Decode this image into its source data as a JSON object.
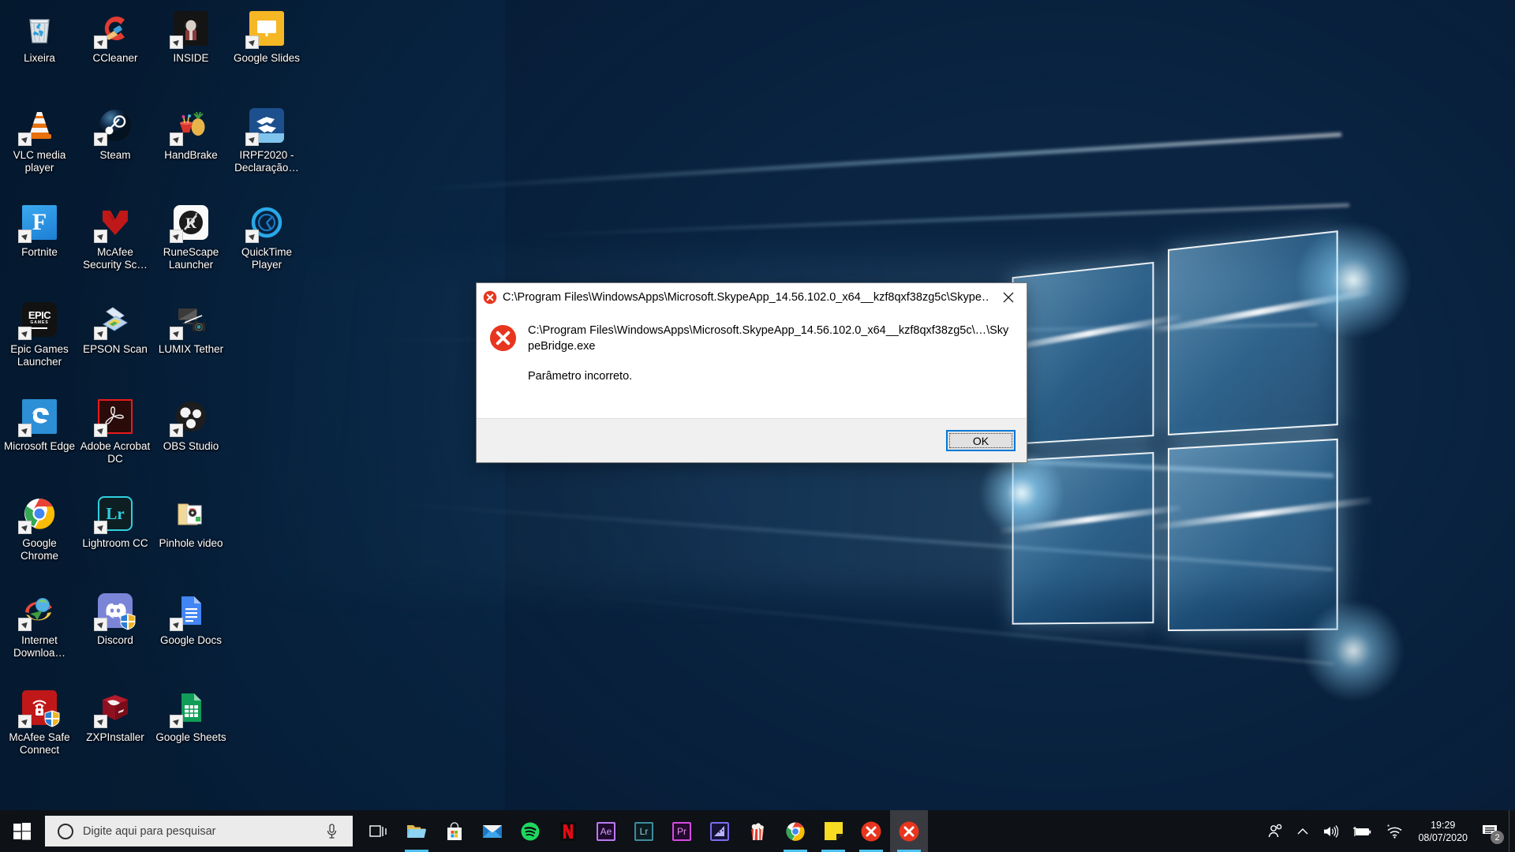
{
  "desktop": {
    "icons": [
      {
        "label": "Lixeira",
        "icon": "recycle-bin-icon",
        "shortcut": false
      },
      {
        "label": "CCleaner",
        "icon": "ccleaner-icon",
        "shortcut": true
      },
      {
        "label": "INSIDE",
        "icon": "inside-game-icon",
        "shortcut": true
      },
      {
        "label": "Google Slides",
        "icon": "google-slides-icon",
        "shortcut": true
      },
      {
        "label": "VLC media player",
        "icon": "vlc-media-player-icon",
        "shortcut": true
      },
      {
        "label": "Steam",
        "icon": "steam-icon",
        "shortcut": true
      },
      {
        "label": "HandBrake",
        "icon": "handbrake-icon",
        "shortcut": true
      },
      {
        "label": "IRPF2020 - Declaração…",
        "icon": "irpf2020-icon",
        "shortcut": true
      },
      {
        "label": "Fortnite",
        "icon": "fortnite-icon",
        "shortcut": true
      },
      {
        "label": "McAfee Security Sc…",
        "icon": "mcafee-security-icon",
        "shortcut": true
      },
      {
        "label": "RuneScape Launcher",
        "icon": "runescape-launcher-icon",
        "shortcut": true
      },
      {
        "label": "QuickTime Player",
        "icon": "quicktime-player-icon",
        "shortcut": true
      },
      {
        "label": "Epic Games Launcher",
        "icon": "epic-games-icon",
        "shortcut": true
      },
      {
        "label": "EPSON Scan",
        "icon": "epson-scan-icon",
        "shortcut": true
      },
      {
        "label": "LUMIX Tether",
        "icon": "lumix-tether-icon",
        "shortcut": true
      },
      {
        "label": "",
        "icon": "empty-slot",
        "shortcut": false
      },
      {
        "label": "Microsoft Edge",
        "icon": "microsoft-edge-icon",
        "shortcut": true
      },
      {
        "label": "Adobe Acrobat DC",
        "icon": "adobe-acrobat-icon",
        "shortcut": true
      },
      {
        "label": "OBS Studio",
        "icon": "obs-studio-icon",
        "shortcut": true
      },
      {
        "label": "",
        "icon": "empty-slot",
        "shortcut": false
      },
      {
        "label": "Google Chrome",
        "icon": "google-chrome-icon",
        "shortcut": true
      },
      {
        "label": "Lightroom CC",
        "icon": "lightroom-cc-icon",
        "shortcut": true
      },
      {
        "label": "Pinhole video",
        "icon": "folder-icon",
        "shortcut": false
      },
      {
        "label": "",
        "icon": "empty-slot",
        "shortcut": false
      },
      {
        "label": "Internet Downloa…",
        "icon": "internet-download-manager-icon",
        "shortcut": true
      },
      {
        "label": "Discord",
        "icon": "discord-icon",
        "shortcut": true
      },
      {
        "label": "Google Docs",
        "icon": "google-docs-icon",
        "shortcut": true
      },
      {
        "label": "",
        "icon": "empty-slot",
        "shortcut": false
      },
      {
        "label": "McAfee Safe Connect",
        "icon": "mcafee-safe-connect-icon",
        "shortcut": true
      },
      {
        "label": "ZXPInstaller",
        "icon": "zxpinstaller-icon",
        "shortcut": true
      },
      {
        "label": "Google Sheets",
        "icon": "google-sheets-icon",
        "shortcut": true
      },
      {
        "label": "",
        "icon": "empty-slot",
        "shortcut": false
      }
    ]
  },
  "dialog": {
    "title": "C:\\Program Files\\WindowsApps\\Microsoft.SkypeApp_14.56.102.0_x64__kzf8qxf38zg5c\\Skype…",
    "title_icon": "error-icon",
    "close_label": "✕",
    "body_icon": "error-icon",
    "message_path": "C:\\Program Files\\WindowsApps\\Microsoft.SkypeApp_14.56.102.0_x64__kzf8qxf38zg5c\\…\\SkypeBridge.exe",
    "message_reason": "Parâmetro incorreto.",
    "ok_label": "OK",
    "accent_color": "#0078d7",
    "error_color": "#e8351e"
  },
  "taskbar": {
    "start_label": "start-button",
    "search": {
      "placeholder": "Digite aqui para pesquisar",
      "cortana_icon": "cortana-circle-icon",
      "mic_icon": "microphone-icon"
    },
    "apps": [
      {
        "name": "task-view",
        "icon": "task-view-icon",
        "running": false,
        "active": false
      },
      {
        "name": "file-explorer",
        "icon": "file-explorer-icon",
        "running": true,
        "active": false
      },
      {
        "name": "microsoft-store",
        "icon": "microsoft-store-icon",
        "running": false,
        "active": false
      },
      {
        "name": "mail",
        "icon": "mail-icon",
        "running": false,
        "active": false
      },
      {
        "name": "spotify",
        "icon": "spotify-icon",
        "running": false,
        "active": false
      },
      {
        "name": "netflix",
        "icon": "netflix-icon",
        "running": false,
        "active": false
      },
      {
        "name": "after-effects",
        "icon": "after-effects-icon",
        "running": false,
        "active": false
      },
      {
        "name": "lightroom",
        "icon": "lightroom-icon",
        "running": false,
        "active": false
      },
      {
        "name": "premiere-pro",
        "icon": "premiere-pro-icon",
        "running": false,
        "active": false
      },
      {
        "name": "media-encoder",
        "icon": "media-encoder-icon",
        "running": false,
        "active": false
      },
      {
        "name": "popcorn-time",
        "icon": "popcorn-time-icon",
        "running": false,
        "active": false
      },
      {
        "name": "google-chrome",
        "icon": "chrome-icon",
        "running": true,
        "active": false
      },
      {
        "name": "sticky-notes",
        "icon": "sticky-notes-icon",
        "running": true,
        "active": false
      },
      {
        "name": "skype-error-1",
        "icon": "error-icon",
        "running": true,
        "active": false
      },
      {
        "name": "skype-error-2",
        "icon": "error-icon",
        "running": true,
        "active": true
      }
    ],
    "tray": {
      "people_icon": "people-icon",
      "chevron_icon": "chevron-up-icon",
      "volume_icon": "volume-icon",
      "battery_icon": "battery-charging-icon",
      "network_icon": "wifi-icon",
      "time": "19:29",
      "date": "08/07/2020",
      "notification_icon": "action-center-icon",
      "notification_count": "2"
    }
  }
}
